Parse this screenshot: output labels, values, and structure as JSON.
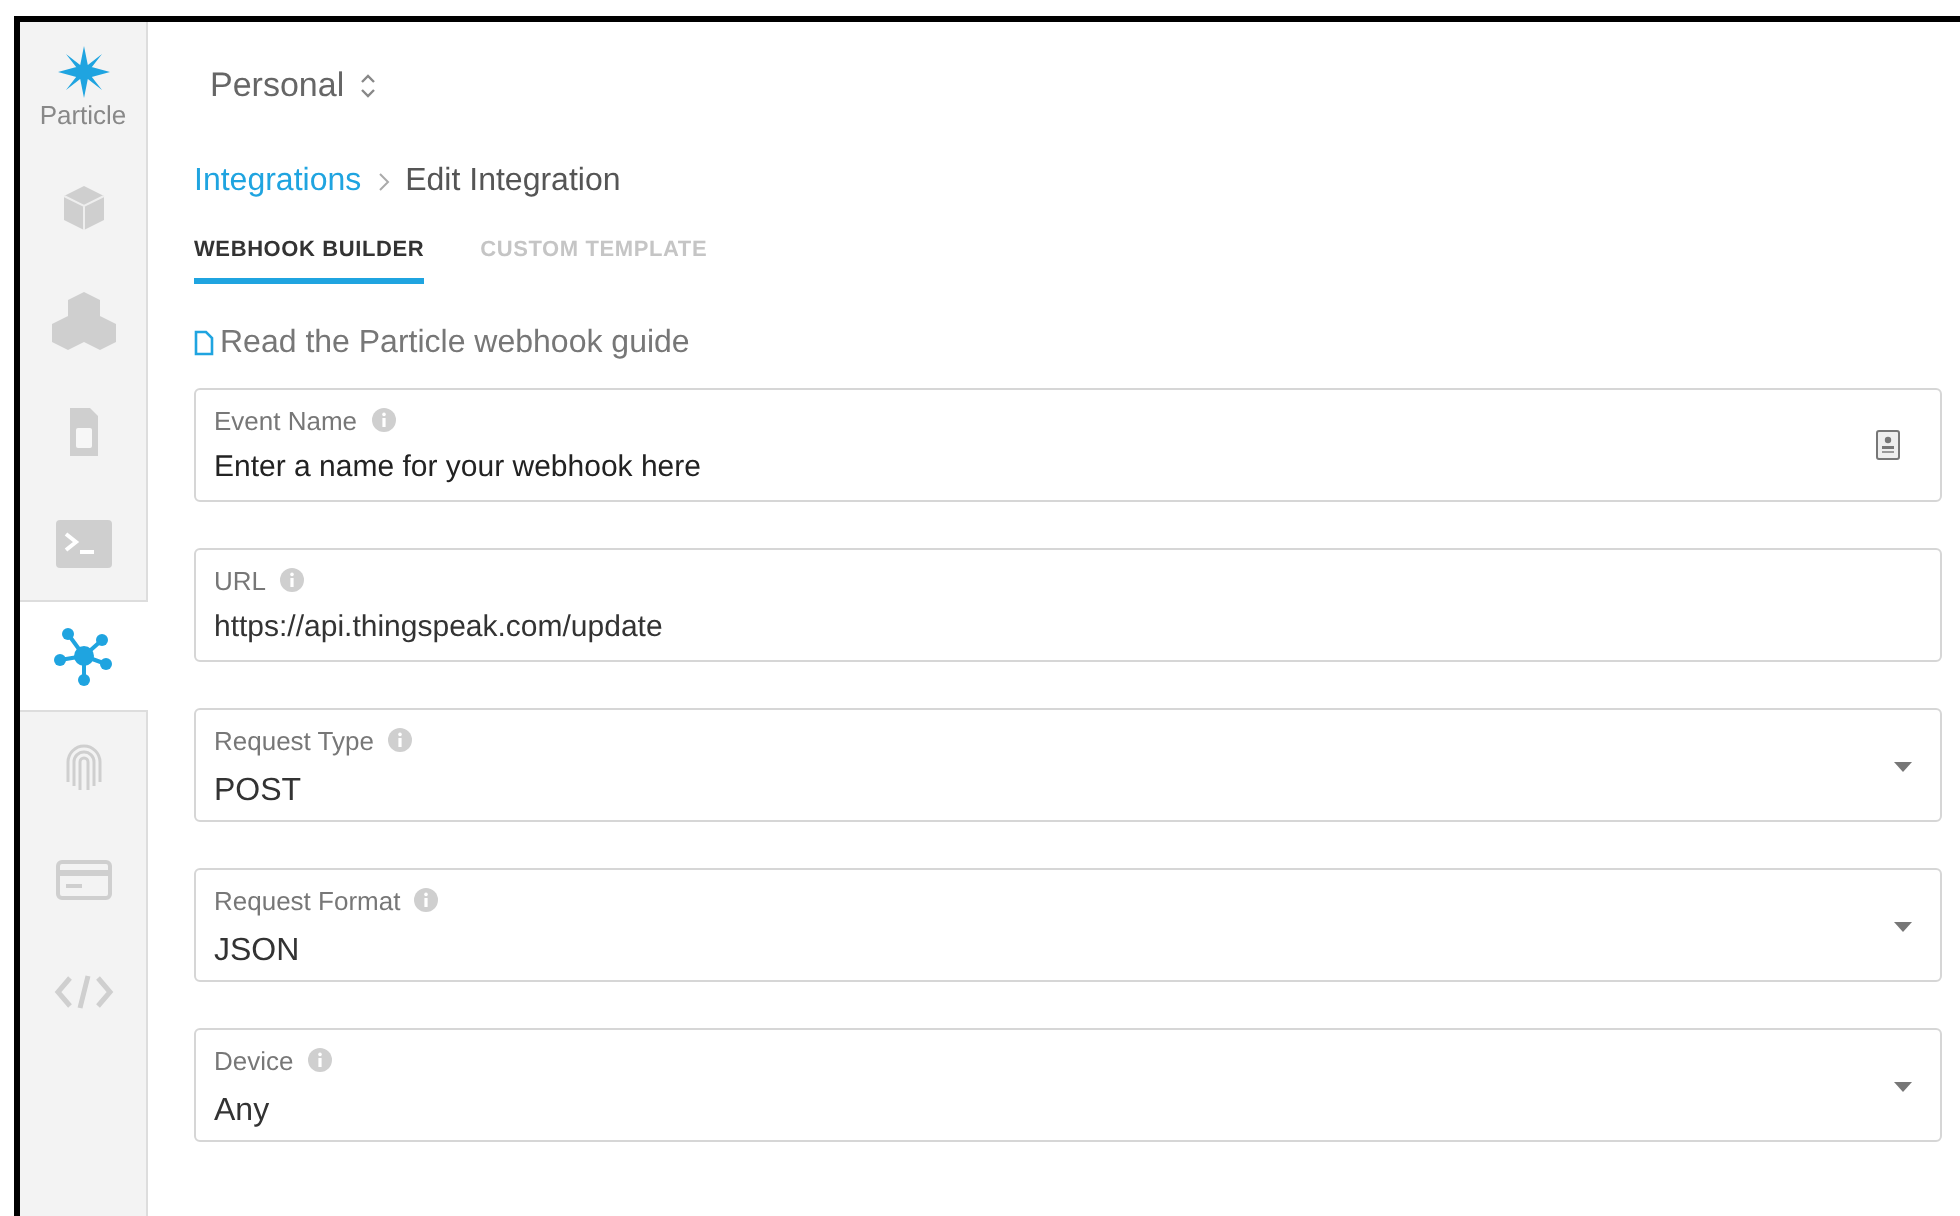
{
  "sidebar": {
    "logo": "Particle",
    "items": [
      {
        "kind": "cube",
        "selected": false
      },
      {
        "kind": "cubes",
        "selected": false
      },
      {
        "kind": "sim",
        "selected": false
      },
      {
        "kind": "terminal",
        "selected": false
      },
      {
        "kind": "network",
        "selected": true
      },
      {
        "kind": "fingerprint",
        "selected": false
      },
      {
        "kind": "card",
        "selected": false
      },
      {
        "kind": "code",
        "selected": false
      }
    ]
  },
  "account": {
    "label": "Personal"
  },
  "breadcrumb": [
    {
      "label": "Integrations",
      "kind": "link"
    },
    {
      "label": "Edit Integration",
      "kind": "current"
    }
  ],
  "tabs": [
    {
      "label": "WEBHOOK BUILDER",
      "selected": true
    },
    {
      "label": "CUSTOM TEMPLATE",
      "selected": false
    }
  ],
  "guide_link": "Read the Particle webhook guide",
  "fields": [
    {
      "kind": "text",
      "label": "Event Name",
      "placeholder": "Enter a name for your webhook here",
      "contact_icon": true
    },
    {
      "kind": "text",
      "label": "URL",
      "value": "https://api.thingspeak.com/update"
    },
    {
      "kind": "select",
      "label": "Request Type",
      "value": "POST"
    },
    {
      "kind": "select",
      "label": "Request Format",
      "value": "JSON"
    },
    {
      "kind": "select",
      "label": "Device",
      "value": "Any"
    }
  ]
}
